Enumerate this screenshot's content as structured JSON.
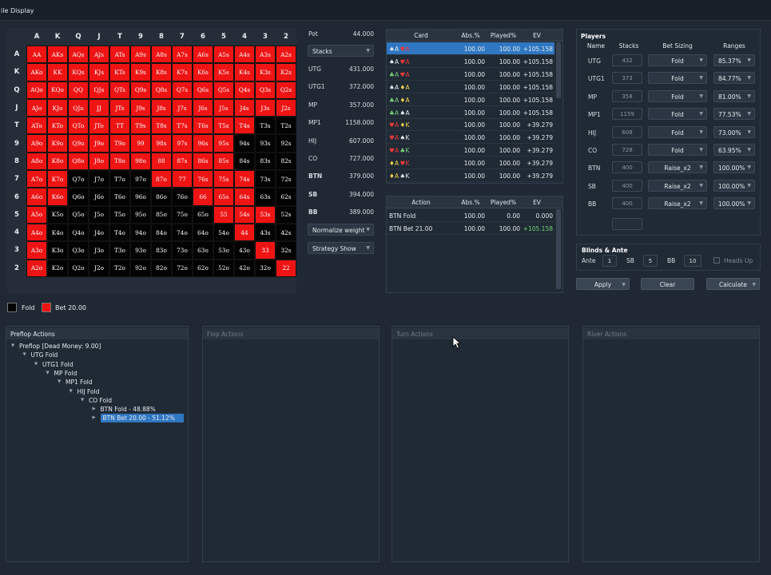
{
  "menu": {
    "file": "ile",
    "display": "Display"
  },
  "grid": {
    "cols": [
      "A",
      "K",
      "Q",
      "J",
      "T",
      "9",
      "8",
      "7",
      "6",
      "5",
      "4",
      "3",
      "2"
    ],
    "rows": [
      "A",
      "K",
      "Q",
      "J",
      "T",
      "9",
      "8",
      "7",
      "6",
      "5",
      "4",
      "3",
      "2"
    ],
    "cells": [
      [
        "AA",
        "AKs",
        "AQs",
        "AJs",
        "ATs",
        "A9s",
        "A8s",
        "A7s",
        "A6s",
        "A5s",
        "A4s",
        "A3s",
        "A2s"
      ],
      [
        "AKo",
        "KK",
        "KQs",
        "KJs",
        "KTs",
        "K9s",
        "K8s",
        "K7s",
        "K6s",
        "K5s",
        "K4s",
        "K3s",
        "K2s"
      ],
      [
        "AQo",
        "KQo",
        "QQ",
        "QJs",
        "QTs",
        "Q9s",
        "Q8s",
        "Q7s",
        "Q6s",
        "Q5s",
        "Q4s",
        "Q3s",
        "Q2s"
      ],
      [
        "AJo",
        "KJo",
        "QJo",
        "JJ",
        "JTs",
        "J9s",
        "J8s",
        "J7s",
        "J6s",
        "J5s",
        "J4s",
        "J3s",
        "J2s"
      ],
      [
        "ATo",
        "KTo",
        "QTo",
        "JTo",
        "TT",
        "T9s",
        "T8s",
        "T7s",
        "T6s",
        "T5s",
        "T4s",
        "T3s",
        "T2s"
      ],
      [
        "A9o",
        "K9o",
        "Q9o",
        "J9o",
        "T9o",
        "99",
        "98s",
        "97s",
        "96s",
        "95s",
        "94s",
        "93s",
        "92s"
      ],
      [
        "A8o",
        "K8o",
        "Q8o",
        "J8o",
        "T8o",
        "98o",
        "88",
        "87s",
        "86s",
        "85s",
        "84s",
        "83s",
        "82s"
      ],
      [
        "A7o",
        "K7o",
        "Q7o",
        "J7o",
        "T7o",
        "97o",
        "87o",
        "77",
        "76s",
        "75s",
        "74s",
        "73s",
        "72s"
      ],
      [
        "A6o",
        "K6o",
        "Q6o",
        "J6o",
        "T6o",
        "96o",
        "86o",
        "76o",
        "66",
        "65s",
        "64s",
        "63s",
        "62s"
      ],
      [
        "A5o",
        "K5o",
        "Q5o",
        "J5o",
        "T5o",
        "95o",
        "85o",
        "75o",
        "65o",
        "55",
        "54s",
        "53s",
        "52s"
      ],
      [
        "A4o",
        "K4o",
        "Q4o",
        "J4o",
        "T4o",
        "94o",
        "84o",
        "74o",
        "64o",
        "54o",
        "44",
        "43s",
        "42s"
      ],
      [
        "A3o",
        "K3o",
        "Q3o",
        "J3o",
        "T3o",
        "93o",
        "83o",
        "73o",
        "63o",
        "53o",
        "43o",
        "33",
        "32s"
      ],
      [
        "A2o",
        "K2o",
        "Q2o",
        "J2o",
        "T2o",
        "92o",
        "82o",
        "72o",
        "62o",
        "52o",
        "42o",
        "32o",
        "22"
      ]
    ],
    "actions": [
      "BBBBBBBBBBBBB",
      "BBBBBBBBBBBBB",
      "BBBBBBBBBBBBB",
      "BBBBBBBBBBBBB",
      "BBBBBBBBBBBFF",
      "BBBBBBBBBBFFF",
      "BBBBBBBBBBFFF",
      "BBFFFFBBBBBFF",
      "BBFFFFFFBBBFF",
      "BFFFFFFFFBBBF",
      "BFFFFFFFFFBFF",
      "BFFFFFFFFFFBF",
      "BFFFFFFFFFFFB"
    ]
  },
  "legend": {
    "fold": "Fold",
    "bet": "Bet 20.00",
    "fold_color": "#030303",
    "bet_color": "#ef1414"
  },
  "stack_panel": {
    "pot_label": "Pot",
    "pot_value": "44.000",
    "stacks_dropdown": "Stacks",
    "players": [
      {
        "name": "UTG",
        "value": "431.000"
      },
      {
        "name": "UTG1",
        "value": "372.000"
      },
      {
        "name": "MP",
        "value": "357.000"
      },
      {
        "name": "MP1",
        "value": "1158.000"
      },
      {
        "name": "HIJ",
        "value": "607.000"
      },
      {
        "name": "CO",
        "value": "727.000"
      },
      {
        "name": "BTN",
        "value": "379.000"
      },
      {
        "name": "SB",
        "value": "394.000"
      },
      {
        "name": "BB",
        "value": "389.000"
      }
    ],
    "normalize_dropdown": "Normalize weight",
    "strategy_dropdown": "Strategy Show"
  },
  "card_table": {
    "headers": [
      "Card",
      "Abs.%",
      "Played%",
      "EV"
    ],
    "rows": [
      {
        "c1": "♠A",
        "s1": "ss",
        "c2": "♥A",
        "s2": "sh",
        "abs": "100.00",
        "played": "100.00",
        "ev": "+105.158",
        "sel": true
      },
      {
        "c1": "♠A",
        "s1": "ss",
        "c2": "♥A",
        "s2": "sh",
        "abs": "100.00",
        "played": "100.00",
        "ev": "+105.158",
        "sel": false
      },
      {
        "c1": "♣A",
        "s1": "sc",
        "c2": "♥A",
        "s2": "sh",
        "abs": "100.00",
        "played": "100.00",
        "ev": "+105.158",
        "sel": false
      },
      {
        "c1": "♠A",
        "s1": "ss",
        "c2": "♦A",
        "s2": "sd",
        "abs": "100.00",
        "played": "100.00",
        "ev": "+105.158",
        "sel": false
      },
      {
        "c1": "♣A",
        "s1": "sc",
        "c2": "♦A",
        "s2": "sd",
        "abs": "100.00",
        "played": "100.00",
        "ev": "+105.158",
        "sel": false
      },
      {
        "c1": "♣A",
        "s1": "sc",
        "c2": "♠A",
        "s2": "ss",
        "abs": "100.00",
        "played": "100.00",
        "ev": "+105.158",
        "sel": false
      },
      {
        "c1": "♥A",
        "s1": "sh",
        "c2": "♦K",
        "s2": "sd",
        "abs": "100.00",
        "played": "100.00",
        "ev": "+39.279",
        "sel": false
      },
      {
        "c1": "♥A",
        "s1": "sh",
        "c2": "♠K",
        "s2": "ss",
        "abs": "100.00",
        "played": "100.00",
        "ev": "+39.279",
        "sel": false
      },
      {
        "c1": "♥A",
        "s1": "sh",
        "c2": "♣K",
        "s2": "sc",
        "abs": "100.00",
        "played": "100.00",
        "ev": "+39.279",
        "sel": false
      },
      {
        "c1": "♦A",
        "s1": "sd",
        "c2": "♥K",
        "s2": "sh",
        "abs": "100.00",
        "played": "100.00",
        "ev": "+39.279",
        "sel": false
      },
      {
        "c1": "♦A",
        "s1": "sd",
        "c2": "♠K",
        "s2": "ss",
        "abs": "100.00",
        "played": "100.00",
        "ev": "+39.279",
        "sel": false
      }
    ]
  },
  "action_table": {
    "headers": [
      "Action",
      "Abs.%",
      "Played%",
      "EV"
    ],
    "rows": [
      {
        "action": "BTN Fold",
        "abs": "100.00",
        "played": "0.00",
        "ev": "0.000",
        "ev_color": "#e6eaef"
      },
      {
        "action": "BTN Bet 21.00",
        "abs": "100.00",
        "played": "100.00",
        "ev": "+105.158",
        "ev_color": "#6fd36f"
      }
    ]
  },
  "players_panel": {
    "title": "Players",
    "headers": [
      "Name",
      "Stacks",
      "Bet Sizing",
      "Ranges"
    ],
    "rows": [
      {
        "name": "UTG",
        "stack": "432",
        "sizing": "Fold",
        "range": "85.37%"
      },
      {
        "name": "UTG1",
        "stack": "373",
        "sizing": "Fold",
        "range": "84.77%"
      },
      {
        "name": "MP",
        "stack": "358",
        "sizing": "Fold",
        "range": "81.00%"
      },
      {
        "name": "MP1",
        "stack": "1159",
        "sizing": "Fold",
        "range": "77.53%"
      },
      {
        "name": "HIJ",
        "stack": "608",
        "sizing": "Fold",
        "range": "73.00%"
      },
      {
        "name": "CO",
        "stack": "728",
        "sizing": "Fold",
        "range": "63.95%"
      },
      {
        "name": "BTN",
        "stack": "400",
        "sizing": "Raise_x2",
        "range": "100.00%"
      },
      {
        "name": "SB",
        "stack": "400",
        "sizing": "Raise_x2",
        "range": "100.00%"
      },
      {
        "name": "BB",
        "stack": "400",
        "sizing": "Raise_x2",
        "range": "100.00%"
      }
    ]
  },
  "blinds": {
    "title": "Blinds & Ante",
    "ante_label": "Ante",
    "ante": "1",
    "sb_label": "SB",
    "sb": "5",
    "bb_label": "BB",
    "bb": "10",
    "heads_up": "Heads Up"
  },
  "buttons": {
    "apply": "Apply",
    "clear": "Clear",
    "calculate": "Calculate"
  },
  "action_panels": {
    "preflop": "Preflop Actions",
    "flop": "Flop Actions",
    "turn": "Turn Actions",
    "river": "River Actions"
  },
  "tree": [
    {
      "label": "Preflop [Dead Money: 9.00]",
      "level": 0,
      "sel": false
    },
    {
      "label": "UTG Fold",
      "level": 1,
      "sel": false
    },
    {
      "label": "UTG1 Fold",
      "level": 2,
      "sel": false
    },
    {
      "label": "MP Fold",
      "level": 3,
      "sel": false
    },
    {
      "label": "MP1 Fold",
      "level": 4,
      "sel": false
    },
    {
      "label": "HIJ Fold",
      "level": 5,
      "sel": false
    },
    {
      "label": "CO Fold",
      "level": 6,
      "sel": false
    },
    {
      "label": "BTN Fold - 48.88%",
      "level": 7,
      "sel": false
    },
    {
      "label": "BTN Bet 20.00 - 51.12%",
      "level": 7,
      "sel": true
    }
  ]
}
